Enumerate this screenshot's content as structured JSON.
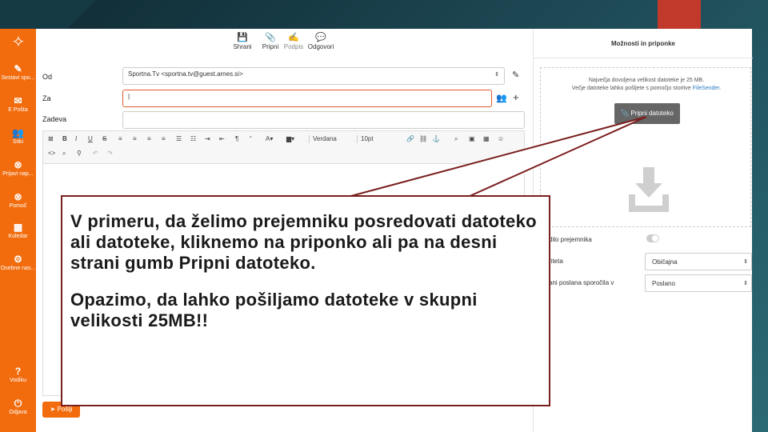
{
  "sidebar": {
    "logo_icon": "compass-logo-icon",
    "items": [
      {
        "icon": "compose-icon",
        "glyph": "✎",
        "label": "Sestavi spo..."
      },
      {
        "icon": "envelope-icon",
        "glyph": "✉",
        "label": "E Pošta"
      },
      {
        "icon": "contacts-icon",
        "glyph": "👥",
        "label": "Stiki"
      },
      {
        "icon": "lifebuoy-icon",
        "glyph": "⊗",
        "label": "Prijavi nap..."
      },
      {
        "icon": "help-circle-icon",
        "glyph": "⊗",
        "label": "Pomoč"
      },
      {
        "icon": "calendar-icon",
        "glyph": "▦",
        "label": "Koledar"
      },
      {
        "icon": "gear-icon",
        "glyph": "⚙",
        "label": "Osebne nas..."
      },
      {
        "icon": "question-icon",
        "glyph": "?",
        "label": "Vodiku"
      },
      {
        "icon": "power-icon",
        "glyph": "⏻",
        "label": "Odjava"
      }
    ]
  },
  "toolbar": {
    "save_label": "Shrani",
    "attach_label": "Pripni",
    "signature_label": "Podpis",
    "reply_label": "Odgovori"
  },
  "form": {
    "from_label": "Od",
    "from_value": "Sportna.Tv <sportna.tv@guest.arnes.si>",
    "to_label": "Za",
    "to_value": "|",
    "subject_label": "Zadeva",
    "subject_value": ""
  },
  "editor": {
    "font_name": "Verdana",
    "font_size": "10pt"
  },
  "send_label": "Pošlji",
  "right_panel": {
    "title": "Možnosti in priponke",
    "limit_text": "Največja dovoljena velikost datoteke je 25 MB.",
    "bigger_text": "Večje datoteke lahko pošljete s pomočjo storitve",
    "filesender": "FileSender.",
    "attach_button": "Pripni datoteko",
    "opt_receipt": "dilo prejemnika",
    "opt_priority": "riteta",
    "opt_priority_value": "Običajna",
    "opt_sent": "ani poslana sporočila v",
    "opt_sent_value": "Poslano"
  },
  "callout": {
    "text1": "V primeru, da želimo prejemniku posredovati datoteko ali datoteke, kliknemo na priponko ali pa na desni strani gumb Pripni datoteko.",
    "text2": "Opazimo, da lahko pošiljamo datoteke v skupni velikosti 25MB!!"
  },
  "colors": {
    "accent": "#f26c0d",
    "callout_border": "#7a1e1e",
    "link": "#2a7bbf"
  }
}
